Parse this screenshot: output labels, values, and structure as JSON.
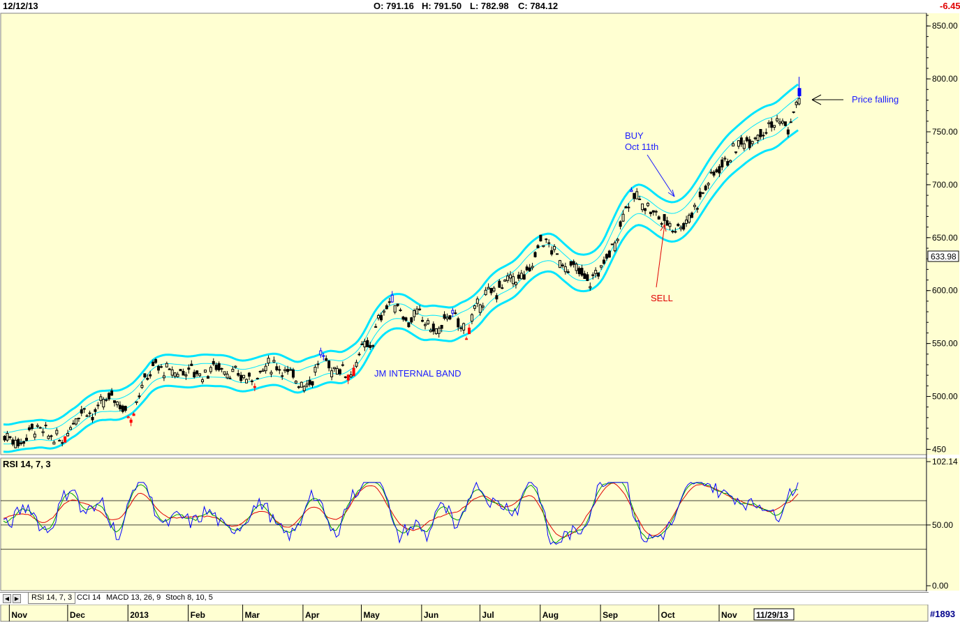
{
  "header": {
    "date": "12/12/13",
    "open": "O: 791.16",
    "high": "H: 791.50",
    "low": "L: 782.98",
    "close": "C: 784.12",
    "change": "-6.45"
  },
  "chart_data": [
    {
      "type": "candlestick",
      "title": "",
      "y_ticks": [
        "850.00",
        "800.00",
        "750.00",
        "700.00",
        "650.00",
        "600.00",
        "550.00",
        "500.00",
        "450"
      ],
      "ylim": [
        445,
        862
      ],
      "price_marker": "633.98",
      "x_months": [
        "Nov",
        "Dec",
        "2013",
        "Feb",
        "Mar",
        "Apr",
        "May",
        "Jun",
        "Jul",
        "Aug",
        "Sep",
        "Oct",
        "Nov"
      ],
      "x_cursor_label": "11/29/13",
      "band_label": "JM INTERNAL BAND",
      "annotations": {
        "buy": [
          "BUY",
          "Oct 11th"
        ],
        "sell": "SELL",
        "falling": "Price falling"
      },
      "price_path": {
        "dates": [
          "2012-11-01",
          "2012-11-06",
          "2012-11-12",
          "2012-11-16",
          "2012-11-22",
          "2012-11-28",
          "2012-12-04",
          "2012-12-10",
          "2012-12-13",
          "2012-12-18",
          "2012-12-24",
          "2013-01-02",
          "2013-01-07",
          "2013-01-14",
          "2013-01-18",
          "2013-01-25",
          "2013-02-01",
          "2013-02-08",
          "2013-02-15",
          "2013-02-22",
          "2013-03-01",
          "2013-03-06",
          "2013-03-12",
          "2013-03-18",
          "2013-03-25",
          "2013-04-01",
          "2013-04-05",
          "2013-04-10",
          "2013-04-15",
          "2013-04-19",
          "2013-04-25",
          "2013-05-01",
          "2013-05-06",
          "2013-05-10",
          "2013-05-15",
          "2013-05-20",
          "2013-05-24",
          "2013-05-30",
          "2013-06-05",
          "2013-06-10",
          "2013-06-14",
          "2013-06-19",
          "2013-06-24",
          "2013-06-28",
          "2013-07-03",
          "2013-07-09",
          "2013-07-15",
          "2013-07-22",
          "2013-07-26",
          "2013-08-01",
          "2013-08-06",
          "2013-08-12",
          "2013-08-19",
          "2013-08-26",
          "2013-09-02",
          "2013-09-09",
          "2013-09-13",
          "2013-09-18",
          "2013-09-24",
          "2013-09-30",
          "2013-10-04",
          "2013-10-09",
          "2013-10-15",
          "2013-10-22",
          "2013-10-30",
          "2013-11-05",
          "2013-11-12",
          "2013-11-18",
          "2013-11-25",
          "2013-12-02",
          "2013-12-06",
          "2013-12-12"
        ],
        "close": [
          462,
          455,
          470,
          468,
          462,
          458,
          480,
          490,
          480,
          493,
          500,
          480,
          508,
          530,
          525,
          522,
          526,
          520,
          530,
          522,
          518,
          515,
          528,
          530,
          520,
          512,
          515,
          540,
          525,
          528,
          520,
          545,
          550,
          575,
          590,
          585,
          570,
          578,
          565,
          560,
          580,
          570,
          560,
          580,
          595,
          600,
          610,
          612,
          618,
          650,
          640,
          625,
          620,
          608,
          625,
          650,
          680,
          690,
          680,
          670,
          665,
          660,
          665,
          690,
          715,
          725,
          740,
          745,
          755,
          760,
          752,
          784
        ]
      },
      "rsi": {
        "label": "RSI 14, 7, 3",
        "y_ticks": [
          "102.14",
          "50.00",
          "0.00"
        ],
        "ylim": [
          0,
          102.14
        ],
        "levels": [
          70,
          50,
          30
        ],
        "lines": [
          "blue",
          "green",
          "red"
        ]
      }
    }
  ],
  "tabs": [
    "RSI 14, 7, 3",
    "CCI 14",
    "MACD 13, 26, 9",
    "Stoch 8, 10, 5"
  ],
  "footer": {
    "badge": "#1893"
  },
  "colors": {
    "panel_bg": "#ffffd2",
    "band": "#00e5ff",
    "up_candle": "#0000ff",
    "down_candle": "#ff0000",
    "neutral_candle": "#000000",
    "annotation_blue": "#1a1aff",
    "annotation_red": "#e00000"
  }
}
